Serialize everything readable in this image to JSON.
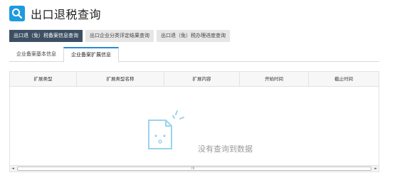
{
  "header": {
    "icon": "search-icon",
    "title": "出口退税查询",
    "accent_color": "#1e9ae0"
  },
  "top_tabs": [
    {
      "label": "出口退（免）税备案信息查询",
      "active": true
    },
    {
      "label": "出口企业分类评定结果查询",
      "active": false
    },
    {
      "label": "出口退（免）税办理进度查询",
      "active": false
    }
  ],
  "sub_tabs": [
    {
      "label": "企业备案基本信息",
      "active": false
    },
    {
      "label": "企业备案扩展信息",
      "active": true
    }
  ],
  "table": {
    "columns": [
      "扩展类型",
      "扩展类型名称",
      "扩展内容",
      "开始时间",
      "截止时间"
    ],
    "rows": [],
    "empty_text": "没有查询到数据",
    "empty_icon": "empty-document-icon"
  },
  "scrollbar": {
    "left_arrow": "◄",
    "right_arrow": "►",
    "grip": "III"
  }
}
